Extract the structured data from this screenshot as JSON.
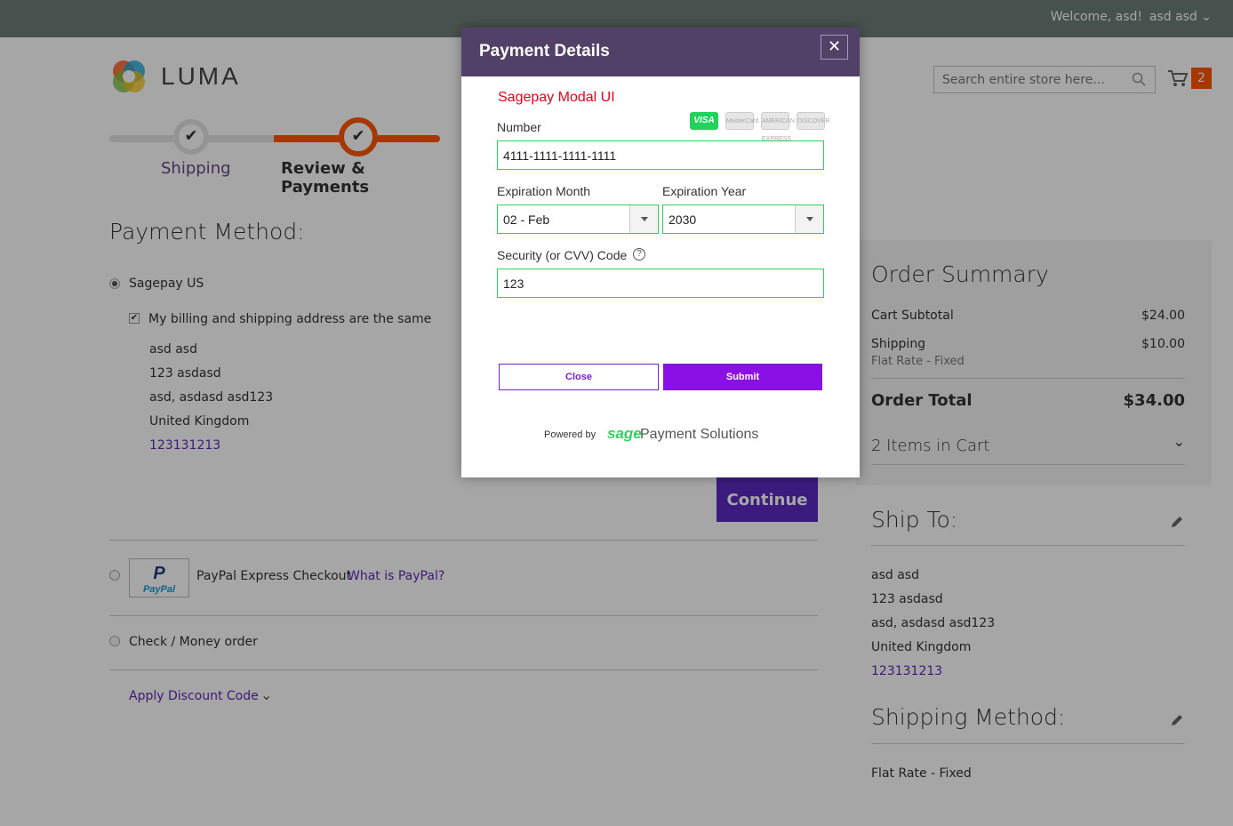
{
  "header": {
    "welcome": "Welcome, asd!",
    "account": "asd asd",
    "brand": "LUMA",
    "search_placeholder": "Search entire store here...",
    "cart_count": "2"
  },
  "progress": {
    "step1": "Shipping",
    "step2": "Review & Payments"
  },
  "payment": {
    "title": "Payment Method:",
    "sagepay_label": "Sagepay US",
    "same_address_label": "My billing and shipping address are the same",
    "address": [
      "asd asd",
      "123 asdasd",
      "asd, asdasd asd123",
      "United Kingdom",
      "123131213"
    ],
    "continue_label": "Continue",
    "paypal_label": "PayPal Express Checkout",
    "paypal_logo_text": "PayPal",
    "what_is_paypal": "What is PayPal?",
    "check_label": "Check / Money order",
    "discount_label": "Apply Discount Code"
  },
  "summary": {
    "title": "Order Summary",
    "subtotal_label": "Cart Subtotal",
    "subtotal": "$24.00",
    "shipping_label": "Shipping",
    "shipping": "$10.00",
    "shipping_method": "Flat Rate - Fixed",
    "total_label": "Order Total",
    "total": "$34.00",
    "items_label": "2 Items in Cart"
  },
  "shipto": {
    "title": "Ship To:",
    "address": [
      "asd asd",
      "123 asdasd",
      "asd, asdasd asd123",
      "United Kingdom",
      "123131213"
    ]
  },
  "shipping_method": {
    "title": "Shipping Method:",
    "value": "Flat Rate - Fixed"
  },
  "modal": {
    "title": "Payment Details",
    "close_glyph": "✕",
    "subtitle": "Sagepay Modal UI",
    "number_label": "Number",
    "number_value": "4111-1111-1111-1111",
    "month_label": "Expiration Month",
    "month_value": "02 - Feb",
    "year_label": "Expiration Year",
    "year_value": "2030",
    "cvv_label": "Security (or CVV) Code",
    "cvv_value": "123",
    "close_button": "Close",
    "submit_button": "Submit",
    "powered_by": "Powered by",
    "sage": "sage",
    "payment_solutions": "Payment Solutions",
    "cards": [
      "VISA",
      "MasterCard",
      "AMERICAN EXPRESS",
      "DISCOVER"
    ]
  },
  "colors": {
    "header_bg": "#514167",
    "accent_orange": "#ff5501",
    "primary_purple": "#5b2cc2",
    "field_border": "#2fd25e",
    "subtitle_red": "#e8001c"
  }
}
